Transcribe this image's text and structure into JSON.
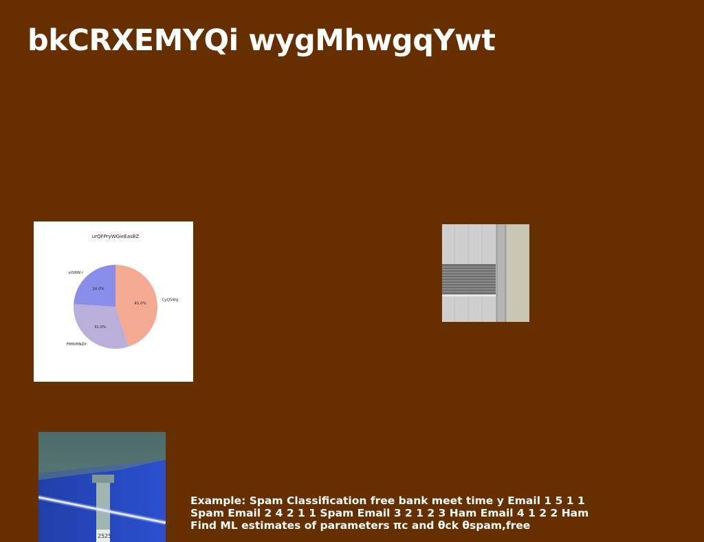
{
  "slide": {
    "title": "bkCRXEMYQi wygMhwgqYwt",
    "body": "Example: Spam Classification free bank meet time y Email 1 5 1 1 Spam Email 2 4 2 1 1 Spam Email 3 2 1 2 3 Ham Email 4 1 2 2 Ham Find ML estimates of parameters πc and θck θspam,free"
  },
  "chart_data": {
    "type": "pie",
    "title": "urQFPryWGieEasBZ",
    "labels": [
      "CyQSWg",
      "FMfkMNZIr",
      "vtSRW r"
    ],
    "values": [
      45.0,
      31.0,
      24.0
    ],
    "percent_labels": [
      "45.0%",
      "31.0%",
      "24.0%"
    ],
    "colors": [
      "#f4a993",
      "#b9afd9",
      "#8b8deb"
    ]
  },
  "images": {
    "building": "building-photo",
    "parking": "parking-garage-photo"
  }
}
